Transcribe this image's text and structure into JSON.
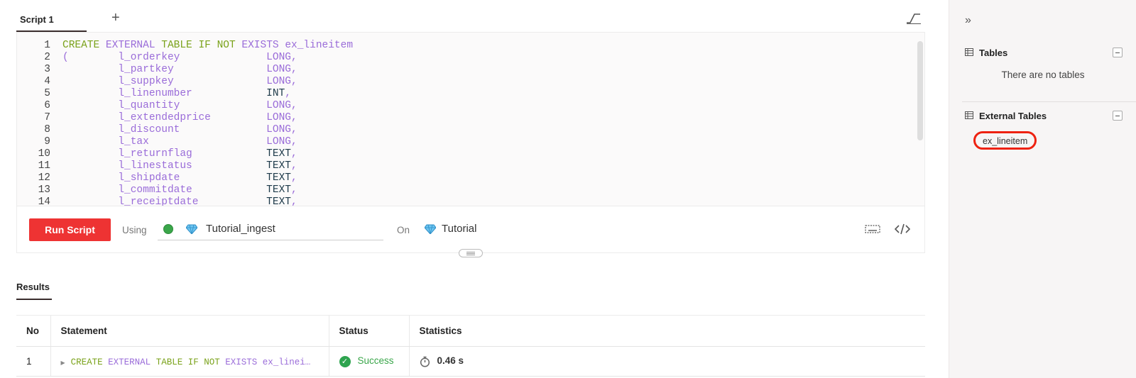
{
  "tabs": [
    {
      "label": "Script 1"
    }
  ],
  "editor": {
    "lines": [
      {
        "n": "1",
        "segs": [
          [
            "kw",
            "CREATE "
          ],
          [
            "id",
            "EXTERNAL "
          ],
          [
            "kw",
            "TABLE "
          ],
          [
            "kw",
            "IF "
          ],
          [
            "kw",
            "NOT "
          ],
          [
            "id",
            "EXISTS "
          ],
          [
            "id",
            "ex_lineitem"
          ]
        ]
      },
      {
        "n": "2",
        "segs": [
          [
            "pn",
            "(        "
          ],
          [
            "id",
            "l_orderkey"
          ],
          [
            "pn",
            "              "
          ],
          [
            "id",
            "LONG"
          ],
          [
            "pn",
            ","
          ]
        ]
      },
      {
        "n": "3",
        "segs": [
          [
            "pn",
            "         "
          ],
          [
            "id",
            "l_partkey"
          ],
          [
            "pn",
            "               "
          ],
          [
            "id",
            "LONG"
          ],
          [
            "pn",
            ","
          ]
        ]
      },
      {
        "n": "4",
        "segs": [
          [
            "pn",
            "         "
          ],
          [
            "id",
            "l_suppkey"
          ],
          [
            "pn",
            "               "
          ],
          [
            "id",
            "LONG"
          ],
          [
            "pn",
            ","
          ]
        ]
      },
      {
        "n": "5",
        "segs": [
          [
            "pn",
            "         "
          ],
          [
            "id",
            "l_linenumber"
          ],
          [
            "pn",
            "            "
          ],
          [
            "ty",
            "INT"
          ],
          [
            "pn",
            ","
          ]
        ]
      },
      {
        "n": "6",
        "segs": [
          [
            "pn",
            "         "
          ],
          [
            "id",
            "l_quantity"
          ],
          [
            "pn",
            "              "
          ],
          [
            "id",
            "LONG"
          ],
          [
            "pn",
            ","
          ]
        ]
      },
      {
        "n": "7",
        "segs": [
          [
            "pn",
            "         "
          ],
          [
            "id",
            "l_extendedprice"
          ],
          [
            "pn",
            "         "
          ],
          [
            "id",
            "LONG"
          ],
          [
            "pn",
            ","
          ]
        ]
      },
      {
        "n": "8",
        "segs": [
          [
            "pn",
            "         "
          ],
          [
            "id",
            "l_discount"
          ],
          [
            "pn",
            "              "
          ],
          [
            "id",
            "LONG"
          ],
          [
            "pn",
            ","
          ]
        ]
      },
      {
        "n": "9",
        "segs": [
          [
            "pn",
            "         "
          ],
          [
            "id",
            "l_tax"
          ],
          [
            "pn",
            "                   "
          ],
          [
            "id",
            "LONG"
          ],
          [
            "pn",
            ","
          ]
        ]
      },
      {
        "n": "10",
        "segs": [
          [
            "pn",
            "         "
          ],
          [
            "id",
            "l_returnflag"
          ],
          [
            "pn",
            "            "
          ],
          [
            "ty",
            "TEXT"
          ],
          [
            "pn",
            ","
          ]
        ]
      },
      {
        "n": "11",
        "segs": [
          [
            "pn",
            "         "
          ],
          [
            "id",
            "l_linestatus"
          ],
          [
            "pn",
            "            "
          ],
          [
            "ty",
            "TEXT"
          ],
          [
            "pn",
            ","
          ]
        ]
      },
      {
        "n": "12",
        "segs": [
          [
            "pn",
            "         "
          ],
          [
            "id",
            "l_shipdate"
          ],
          [
            "pn",
            "              "
          ],
          [
            "ty",
            "TEXT"
          ],
          [
            "pn",
            ","
          ]
        ]
      },
      {
        "n": "13",
        "segs": [
          [
            "pn",
            "         "
          ],
          [
            "id",
            "l_commitdate"
          ],
          [
            "pn",
            "            "
          ],
          [
            "ty",
            "TEXT"
          ],
          [
            "pn",
            ","
          ]
        ]
      },
      {
        "n": "14",
        "segs": [
          [
            "pn",
            "         "
          ],
          [
            "id",
            "l_receiptdate"
          ],
          [
            "pn",
            "           "
          ],
          [
            "ty",
            "TEXT"
          ],
          [
            "pn",
            ","
          ]
        ]
      }
    ]
  },
  "runbar": {
    "run_label": "Run Script",
    "using_label": "Using",
    "engine_name": "Tutorial_ingest",
    "on_label": "On",
    "database_name": "Tutorial"
  },
  "results": {
    "tab_label": "Results",
    "columns": [
      "No",
      "Statement",
      "Status",
      "Statistics"
    ],
    "rows": [
      {
        "no": "1",
        "statement_segs": [
          [
            "kw",
            "CREATE "
          ],
          [
            "id",
            "EXTERNAL "
          ],
          [
            "kw",
            "TABLE "
          ],
          [
            "kw",
            "IF "
          ],
          [
            "kw",
            "NOT "
          ],
          [
            "id",
            "EXISTS "
          ],
          [
            "id",
            "ex_linei…"
          ]
        ],
        "status": "Success",
        "time": "0.46 s"
      }
    ]
  },
  "sidebar": {
    "tables_title": "Tables",
    "no_tables_text": "There are no tables",
    "external_title": "External Tables",
    "external_tables": [
      "ex_lineitem"
    ]
  },
  "colors": {
    "run_button": "#ee3333",
    "success": "#3aa64a",
    "highlight_ring": "#ee2211"
  }
}
